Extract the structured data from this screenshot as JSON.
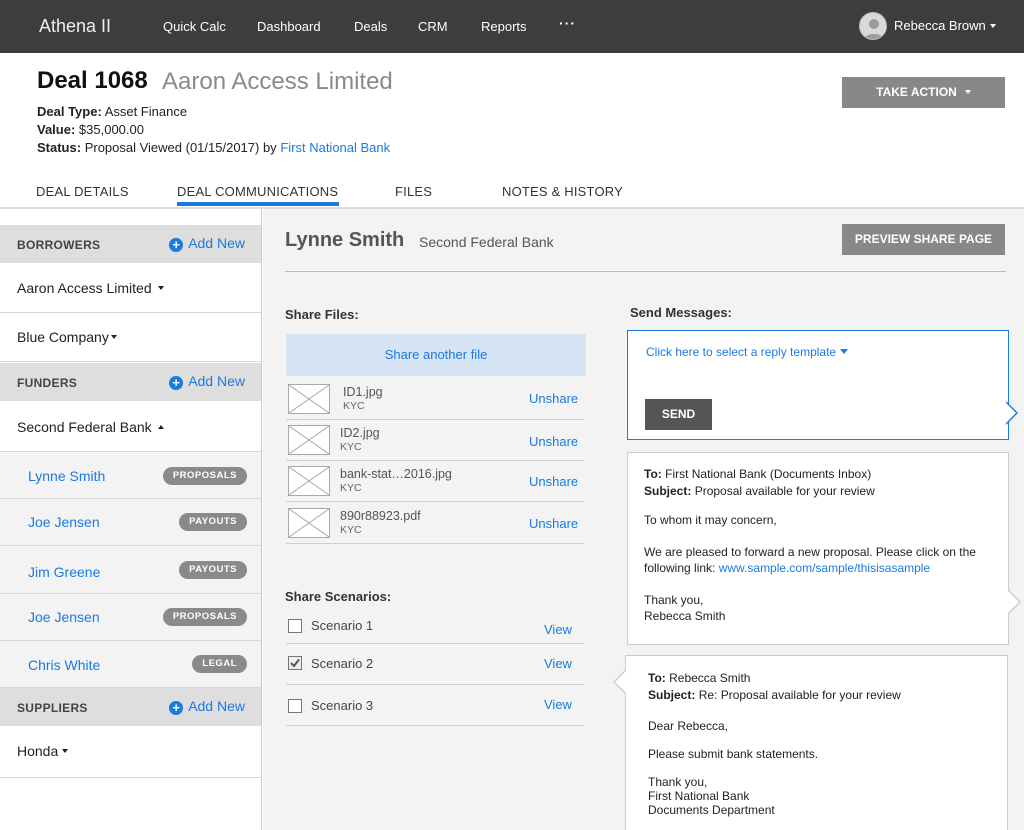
{
  "app": {
    "title": "Athena II",
    "nav": [
      "Quick Calc",
      "Dashboard",
      "Deals",
      "CRM",
      "Reports"
    ],
    "more_label": "···",
    "user_name": "Rebecca Brown"
  },
  "deal": {
    "number": "Deal 1068",
    "name": "Aaron Access Limited",
    "type_label": "Deal Type:",
    "type_value": "Asset Finance",
    "value_label": "Value:",
    "value_value": "$35,000.00",
    "status_label": "Status:",
    "status_value": "Proposal Viewed (01/15/2017) by",
    "status_link": "First National Bank",
    "take_action": "TAKE ACTION"
  },
  "tabs": [
    {
      "label": "DEAL DETAILS"
    },
    {
      "label": "DEAL COMMUNICATIONS",
      "active": true
    },
    {
      "label": "FILES"
    },
    {
      "label": "NOTES & HISTORY"
    }
  ],
  "sidebar": {
    "add_new": "Add New",
    "borrowers": {
      "title": "BORROWERS",
      "items": [
        "Aaron Access Limited",
        "Blue Company"
      ]
    },
    "funders": {
      "title": "FUNDERS",
      "org": "Second Federal Bank",
      "people": [
        {
          "name": "Lynne Smith",
          "badge": "PROPOSALS"
        },
        {
          "name": "Joe Jensen",
          "badge": "PAYOUTS"
        },
        {
          "name": "Jim Greene",
          "badge": "PAYOUTS"
        },
        {
          "name": "Joe Jensen",
          "badge": "PROPOSALS"
        },
        {
          "name": "Chris White",
          "badge": "LEGAL"
        }
      ]
    },
    "suppliers": {
      "title": "SUPPLIERS",
      "items": [
        "Honda"
      ]
    }
  },
  "main": {
    "person_name": "Lynne Smith",
    "person_bank": "Second Federal Bank",
    "preview_button": "PREVIEW SHARE PAGE",
    "share_files": {
      "title": "Share Files:",
      "share_another": "Share another file",
      "unshare_label": "Unshare",
      "files": [
        {
          "name": "ID1.jpg",
          "tag": "KYC"
        },
        {
          "name": "ID2.jpg",
          "tag": "KYC"
        },
        {
          "name": "bank-stat…2016.jpg",
          "tag": "KYC"
        },
        {
          "name": "890r88923.pdf",
          "tag": "KYC"
        }
      ]
    },
    "share_scenarios": {
      "title": "Share Scenarios:",
      "view_label": "View",
      "items": [
        {
          "label": "Scenario 1",
          "checked": false
        },
        {
          "label": "Scenario 2",
          "checked": true
        },
        {
          "label": "Scenario 3",
          "checked": false
        }
      ]
    },
    "messages": {
      "title": "Send Messages:",
      "template_link": "Click here to select a reply template",
      "send_button": "SEND",
      "thread": [
        {
          "to_label": "To:",
          "to": "First National Bank (Documents Inbox)",
          "subject_label": "Subject:",
          "subject": "Proposal available for your review",
          "greeting": "To whom it may concern,",
          "body1": "We are pleased to forward a new proposal. Please click on the",
          "body2": "following link:",
          "link": "www.sample.com/sample/thisisasample",
          "sign1": "Thank you,",
          "sign2": "Rebecca Smith"
        },
        {
          "to_label": "To:",
          "to": "Rebecca Smith",
          "subject_label": "Subject:",
          "subject": "Re: Proposal available for your review",
          "greeting": "Dear Rebecca,",
          "body1": "Please submit bank statements.",
          "sign1": "Thank you,",
          "sign2": "First National Bank",
          "sign3": "Documents Department"
        }
      ]
    }
  }
}
